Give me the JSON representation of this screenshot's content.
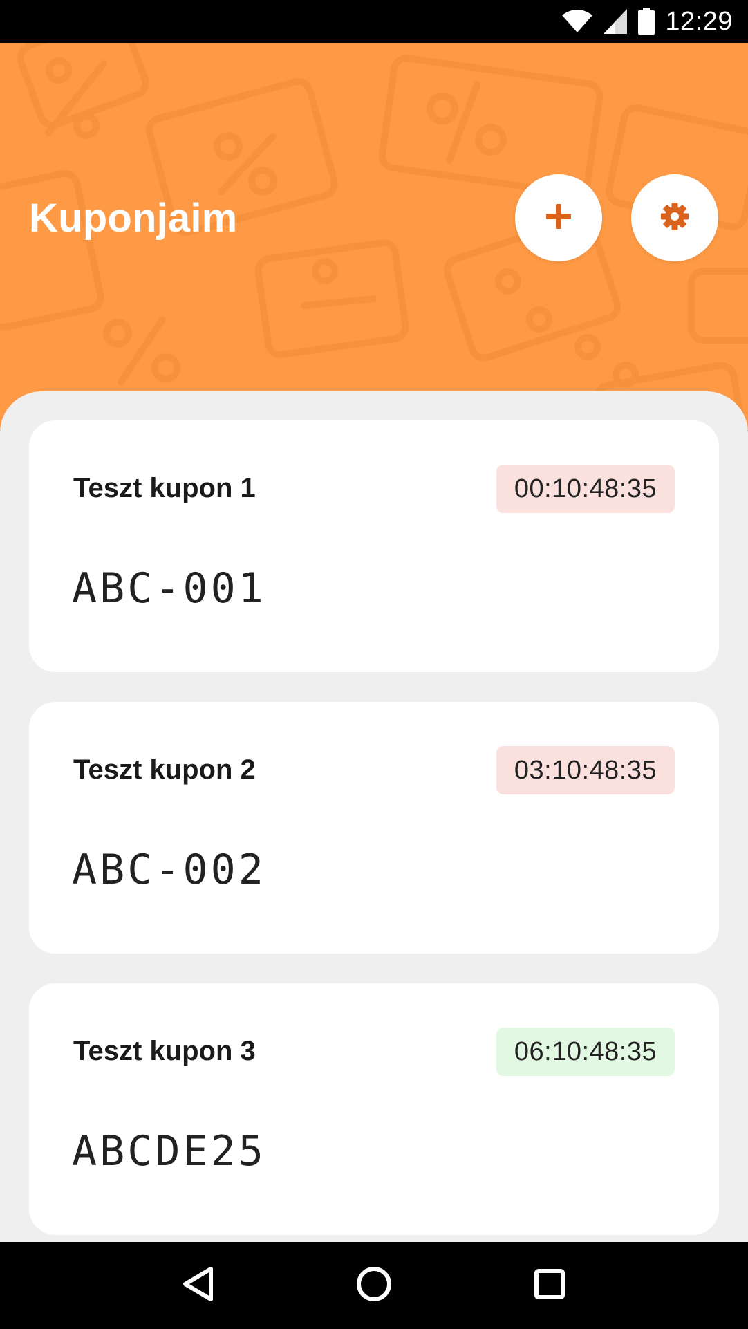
{
  "status_bar": {
    "time": "12:29",
    "icons": [
      "wifi-icon",
      "signal-icon",
      "battery-icon"
    ]
  },
  "header": {
    "title": "Kuponjaim",
    "add_button_icon": "plus-icon",
    "settings_button_icon": "gear-icon",
    "background_color": "#fe9a45",
    "icon_color": "#d9621d"
  },
  "coupons": [
    {
      "name": "Teszt kupon 1",
      "time_left": "00:10:48:35",
      "status": "red",
      "code": "ABC-001"
    },
    {
      "name": "Teszt kupon 2",
      "time_left": "03:10:48:35",
      "status": "red",
      "code": "ABC-002"
    },
    {
      "name": "Teszt kupon 3",
      "time_left": "06:10:48:35",
      "status": "green",
      "code": "ABCDE25"
    }
  ],
  "nav_bar": {
    "icons": [
      "back-icon",
      "home-icon",
      "recents-icon"
    ]
  }
}
